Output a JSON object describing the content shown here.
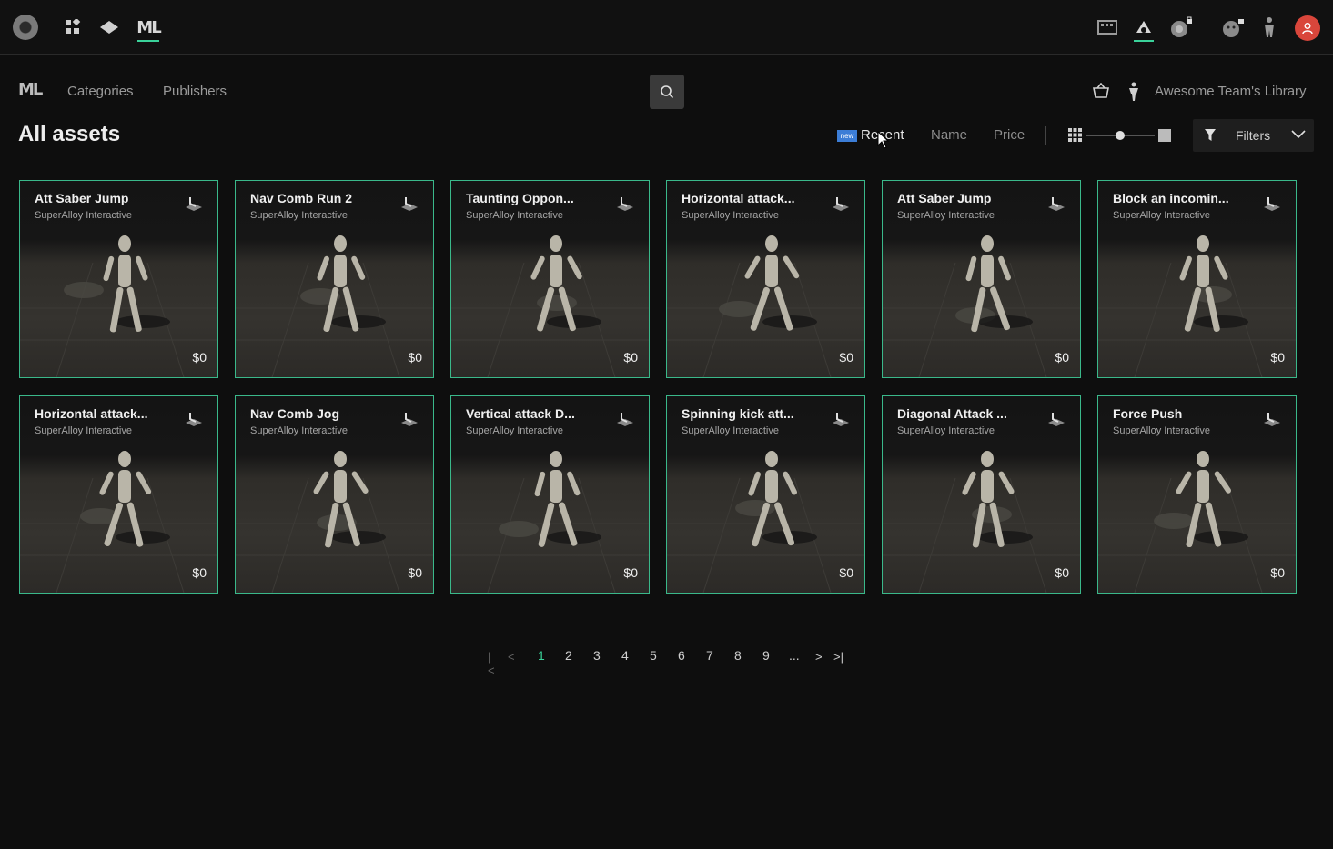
{
  "topbar": {
    "app_logo": "circle-logo-icon",
    "left_icons": [
      "apps-grid-icon",
      "layers-icon",
      "ml-icon"
    ],
    "ml_text": "ML",
    "right_icons": [
      "film-icon",
      "cloud-up-icon",
      "sphere-lock-icon",
      "face-lock-icon",
      "figure-icon",
      "user-avatar-icon"
    ],
    "accent": "#3ad29a",
    "avatar_color": "#d9463b"
  },
  "subnav": {
    "logo": "ML",
    "links": [
      "Categories",
      "Publishers"
    ],
    "library": "Awesome Team's Library"
  },
  "title": "All assets",
  "sort": {
    "badge": "new",
    "options": [
      "Recent",
      "Name",
      "Price"
    ],
    "active": "Recent"
  },
  "view": {
    "size_slider": 0.5
  },
  "filters": {
    "label": "Filters"
  },
  "assets": [
    {
      "title": "Att Saber Jump",
      "publisher": "SuperAlloy Interactive",
      "price": "$0"
    },
    {
      "title": "Nav Comb Run 2",
      "publisher": "SuperAlloy Interactive",
      "price": "$0"
    },
    {
      "title": "Taunting Oppon...",
      "publisher": "SuperAlloy Interactive",
      "price": "$0"
    },
    {
      "title": "Horizontal attack...",
      "publisher": "SuperAlloy Interactive",
      "price": "$0"
    },
    {
      "title": "Att Saber Jump",
      "publisher": "SuperAlloy Interactive",
      "price": "$0"
    },
    {
      "title": "Block an incomin...",
      "publisher": "SuperAlloy Interactive",
      "price": "$0"
    },
    {
      "title": "Horizontal attack...",
      "publisher": "SuperAlloy Interactive",
      "price": "$0"
    },
    {
      "title": "Nav Comb Jog",
      "publisher": "SuperAlloy Interactive",
      "price": "$0"
    },
    {
      "title": "Vertical attack D...",
      "publisher": "SuperAlloy Interactive",
      "price": "$0"
    },
    {
      "title": "Spinning kick att...",
      "publisher": "SuperAlloy Interactive",
      "price": "$0"
    },
    {
      "title": "Diagonal Attack ...",
      "publisher": "SuperAlloy Interactive",
      "price": "$0"
    },
    {
      "title": "Force Push",
      "publisher": "SuperAlloy Interactive",
      "price": "$0"
    }
  ],
  "pagination": {
    "pages": [
      "1",
      "2",
      "3",
      "4",
      "5",
      "6",
      "7",
      "8",
      "9",
      "..."
    ],
    "current": "1"
  }
}
